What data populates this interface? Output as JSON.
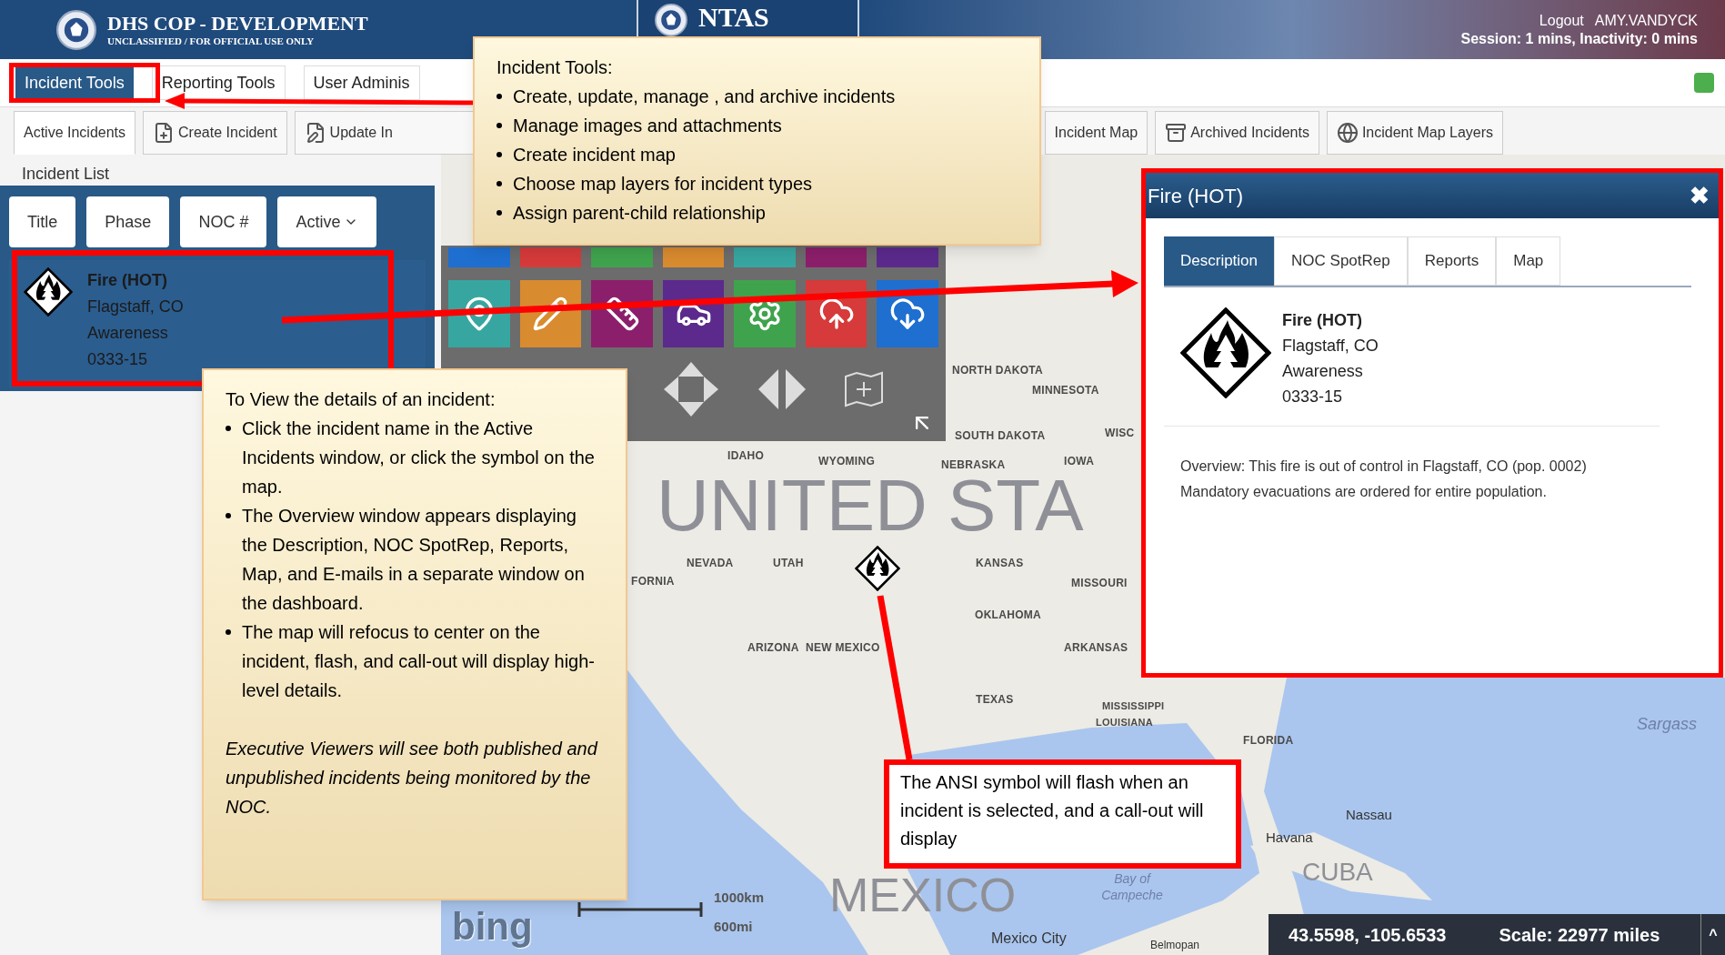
{
  "header": {
    "title": "DHS COP - DEVELOPMENT",
    "subtitle": "UNCLASSIFIED / FOR OFFICIAL USE ONLY",
    "banner": "NTAS",
    "logout": "Logout",
    "user": "AMY.VANDYCK",
    "session": "Session: 1 mins, Inactivity: 0 mins"
  },
  "menu": [
    {
      "label": "Incident Tools",
      "selected": true
    },
    {
      "label": "Reporting Tools",
      "selected": false
    },
    {
      "label": "User Adminis",
      "selected": false
    }
  ],
  "toolbar": [
    {
      "label": "Active Incidents",
      "selected": true
    },
    {
      "label": "Create Incident",
      "selected": false
    },
    {
      "label": "Update In",
      "selected": false
    },
    {
      "label": "Incident Map",
      "selected": false
    },
    {
      "label": "Archived Incidents",
      "selected": false
    },
    {
      "label": "Incident Map Layers",
      "selected": false
    }
  ],
  "incident_list": {
    "title": "Incident List",
    "filters": [
      {
        "label": "Title",
        "kind": "plain"
      },
      {
        "label": "Phase",
        "kind": "plain"
      },
      {
        "label": "NOC #",
        "kind": "plain"
      },
      {
        "label": "Active",
        "kind": "dropdown"
      }
    ],
    "items": [
      {
        "name": "Fire (HOT)",
        "location": "Flagstaff, CO",
        "phase": "Awareness",
        "number": "0333-15",
        "selected": true
      }
    ]
  },
  "map": {
    "labels": [
      {
        "text": "NORTH DAKOTA",
        "kind": "state"
      },
      {
        "text": "MINNESOTA",
        "kind": "state"
      },
      {
        "text": "SOUTH DAKOTA",
        "kind": "state"
      },
      {
        "text": "WISC",
        "kind": "state"
      },
      {
        "text": "IDAHO",
        "kind": "state"
      },
      {
        "text": "WYOMING",
        "kind": "state"
      },
      {
        "text": "IOWA",
        "kind": "state"
      },
      {
        "text": "NEBRASKA",
        "kind": "state"
      },
      {
        "text": "UNITED STA",
        "kind": "country"
      },
      {
        "text": "NEVADA",
        "kind": "state"
      },
      {
        "text": "UTAH",
        "kind": "state"
      },
      {
        "text": "KANSAS",
        "kind": "state"
      },
      {
        "text": "MISSOURI",
        "kind": "state"
      },
      {
        "text": "FORNIA",
        "kind": "state"
      },
      {
        "text": "OKLAHOMA",
        "kind": "state"
      },
      {
        "text": "ARIZONA",
        "kind": "state"
      },
      {
        "text": "NEW MEXICO",
        "kind": "state"
      },
      {
        "text": "ARKANSAS",
        "kind": "state"
      },
      {
        "text": "TEXAS",
        "kind": "state"
      },
      {
        "text": "MISSISSIPPI",
        "kind": "state"
      },
      {
        "text": "LOUISIANA",
        "kind": "state"
      },
      {
        "text": "FLORIDA",
        "kind": "state"
      },
      {
        "text": "Sargass",
        "kind": "water"
      },
      {
        "text": "Nassau",
        "kind": "city"
      },
      {
        "text": "Havana",
        "kind": "city"
      },
      {
        "text": "CUBA",
        "kind": "country"
      },
      {
        "text": "MEXICO",
        "kind": "country"
      },
      {
        "text": "Bay of Campeche",
        "kind": "water"
      },
      {
        "text": "Mexico City",
        "kind": "city"
      },
      {
        "text": "Belmopan",
        "kind": "city"
      }
    ],
    "attribution": "bing",
    "scale_km": "1000km",
    "scale_mi": "600mi",
    "coordinates": "43.5598, -105.6533",
    "scale": "Scale: 22977 miles",
    "expand": "^"
  },
  "popup": {
    "title": "Fire (HOT)",
    "close": "✖",
    "tabs": [
      {
        "label": "Description",
        "selected": true
      },
      {
        "label": "NOC SpotRep",
        "selected": false
      },
      {
        "label": "Reports",
        "selected": false
      },
      {
        "label": "Map",
        "selected": false
      }
    ],
    "incident": {
      "name": "Fire (HOT)",
      "location": "Flagstaff, CO",
      "phase": "Awareness",
      "number": "0333-15"
    },
    "overview": [
      "Overview: This fire is out of control in Flagstaff, CO (pop. 0002)",
      "Mandatory evacuations are ordered for entire population."
    ]
  },
  "callouts": [
    {
      "kind": "note",
      "title": "Incident Tools:",
      "bullets": [
        "Create, update, manage , and archive incidents",
        "Manage images and attachments",
        "Create incident map",
        "Choose map layers for incident types",
        "Assign parent-child relationship"
      ]
    },
    {
      "kind": "note",
      "title": "To View the details of an incident:",
      "bullets": [
        "Click the incident name in the Active Incidents window, or click the symbol on the map.",
        "The Overview window appears displaying the Description, NOC SpotRep, Reports, Map, and E-mails in a separate window on the dashboard.",
        "The map will refocus to center on the incident, flash, and call-out will display high-level details."
      ],
      "remark": "Executive Viewers will see both published and unpublished incidents being monitored by the NOC."
    },
    {
      "kind": "framed",
      "text": "The ANSI symbol will flash when an incident is selected, and a call-out will display"
    }
  ]
}
